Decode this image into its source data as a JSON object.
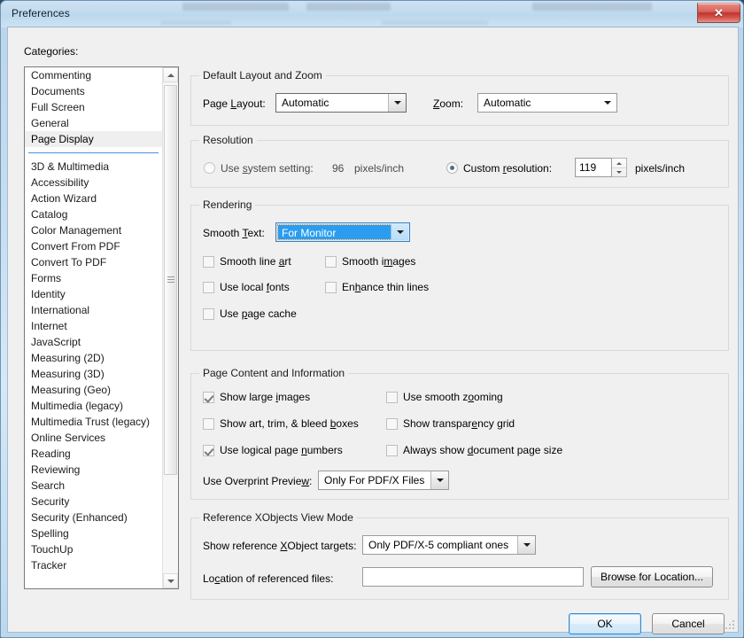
{
  "window": {
    "title": "Preferences",
    "close_label": "✕"
  },
  "categories": {
    "label": "Categories:",
    "selected": "Page Display",
    "items_top": [
      "Commenting",
      "Documents",
      "Full Screen",
      "General",
      "Page Display"
    ],
    "items_bottom": [
      "3D & Multimedia",
      "Accessibility",
      "Action Wizard",
      "Catalog",
      "Color Management",
      "Convert From PDF",
      "Convert To PDF",
      "Forms",
      "Identity",
      "International",
      "Internet",
      "JavaScript",
      "Measuring (2D)",
      "Measuring (3D)",
      "Measuring (Geo)",
      "Multimedia (legacy)",
      "Multimedia Trust (legacy)",
      "Online Services",
      "Reading",
      "Reviewing",
      "Search",
      "Security",
      "Security (Enhanced)",
      "Spelling",
      "TouchUp",
      "Tracker"
    ]
  },
  "default_layout": {
    "legend": "Default Layout and Zoom",
    "page_layout_label": "Page Layout:",
    "page_layout_value": "Automatic",
    "zoom_label": "Zoom:",
    "zoom_value": "Automatic"
  },
  "resolution": {
    "legend": "Resolution",
    "system_label": "Use system setting:",
    "system_value": "96",
    "system_units": "pixels/inch",
    "system_selected": false,
    "custom_label": "Custom resolution:",
    "custom_value": "119",
    "custom_units": "pixels/inch",
    "custom_selected": true
  },
  "rendering": {
    "legend": "Rendering",
    "smooth_text_label": "Smooth Text:",
    "smooth_text_value": "For Monitor",
    "checkboxes": [
      {
        "label": "Smooth line art",
        "checked": false
      },
      {
        "label": "Smooth images",
        "checked": false
      },
      {
        "label": "Use local fonts",
        "checked": false
      },
      {
        "label": "Enhance thin lines",
        "checked": false
      },
      {
        "label": "Use page cache",
        "checked": false
      }
    ]
  },
  "page_content": {
    "legend": "Page Content and Information",
    "checkboxes": [
      {
        "label": "Show large images",
        "checked": true
      },
      {
        "label": "Use smooth zooming",
        "checked": false
      },
      {
        "label": "Show art, trim, & bleed boxes",
        "checked": false
      },
      {
        "label": "Show transparency grid",
        "checked": false
      },
      {
        "label": "Use logical page numbers",
        "checked": true
      },
      {
        "label": "Always show document page size",
        "checked": false
      }
    ],
    "overprint_label": "Use Overprint Preview:",
    "overprint_value": "Only For PDF/X Files"
  },
  "reference_xobjects": {
    "legend": "Reference XObjects View Mode",
    "show_targets_label": "Show reference XObject targets:",
    "show_targets_value": "Only PDF/X-5 compliant ones",
    "location_label": "Location of referenced files:",
    "location_value": "",
    "browse_label": "Browse for Location..."
  },
  "footer": {
    "ok_label": "OK",
    "cancel_label": "Cancel"
  },
  "colors": {
    "accent_blue": "#2a9df0",
    "separator_blue": "#4a90d9",
    "close_red": "#c0332f",
    "panel_bg": "#f0f0f0"
  }
}
